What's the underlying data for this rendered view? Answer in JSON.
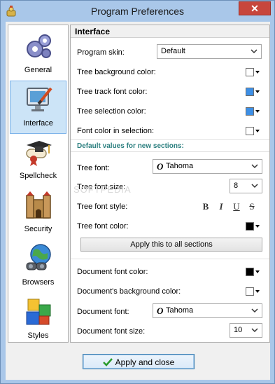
{
  "window": {
    "title": "Program Preferences",
    "close_glyph": "✕"
  },
  "sidebar": {
    "items": [
      {
        "label": "General",
        "icon": "gears-icon"
      },
      {
        "label": "Interface",
        "icon": "monitor-paintbrush-icon",
        "selected": true
      },
      {
        "label": "Spellcheck",
        "icon": "diploma-cap-icon"
      },
      {
        "label": "Security",
        "icon": "castle-icon"
      },
      {
        "label": "Browsers",
        "icon": "globe-binoculars-icon"
      },
      {
        "label": "Styles",
        "icon": "colored-cubes-icon"
      }
    ]
  },
  "panel": {
    "header": "Interface",
    "program_skin": {
      "label": "Program skin:",
      "value": "Default"
    },
    "tree_bg_color": {
      "label": "Tree background color:",
      "color": "#ffffff"
    },
    "tree_track_font_color": {
      "label": "Tree track font color:",
      "color": "#3c8fe6"
    },
    "tree_selection_color": {
      "label": "Tree selection color:",
      "color": "#3c8fe6"
    },
    "font_color_in_selection": {
      "label": "Font color in selection:",
      "color": "#ffffff"
    },
    "section_title": "Default values for new sections:",
    "tree_font": {
      "label": "Tree font:",
      "value": "Tahoma",
      "icon_glyph": "O"
    },
    "tree_font_size": {
      "label": "Tree font size:",
      "value": "8"
    },
    "tree_font_style": {
      "label": "Tree font style:",
      "bold": "B",
      "italic": "I",
      "underline": "U",
      "strike": "S"
    },
    "tree_font_color": {
      "label": "Tree font color:",
      "color": "#000000"
    },
    "apply_all_button": "Apply this to all sections",
    "document_font_color": {
      "label": "Document font color:",
      "color": "#000000"
    },
    "document_bg_color": {
      "label": "Document's background color:",
      "color": "#ffffff"
    },
    "document_font": {
      "label": "Document font:",
      "value": "Tahoma",
      "icon_glyph": "O"
    },
    "document_font_size": {
      "label": "Document font size:",
      "value": "10"
    }
  },
  "footer": {
    "apply_close_button": "Apply and close"
  },
  "watermark": "SOFTPEDIA"
}
